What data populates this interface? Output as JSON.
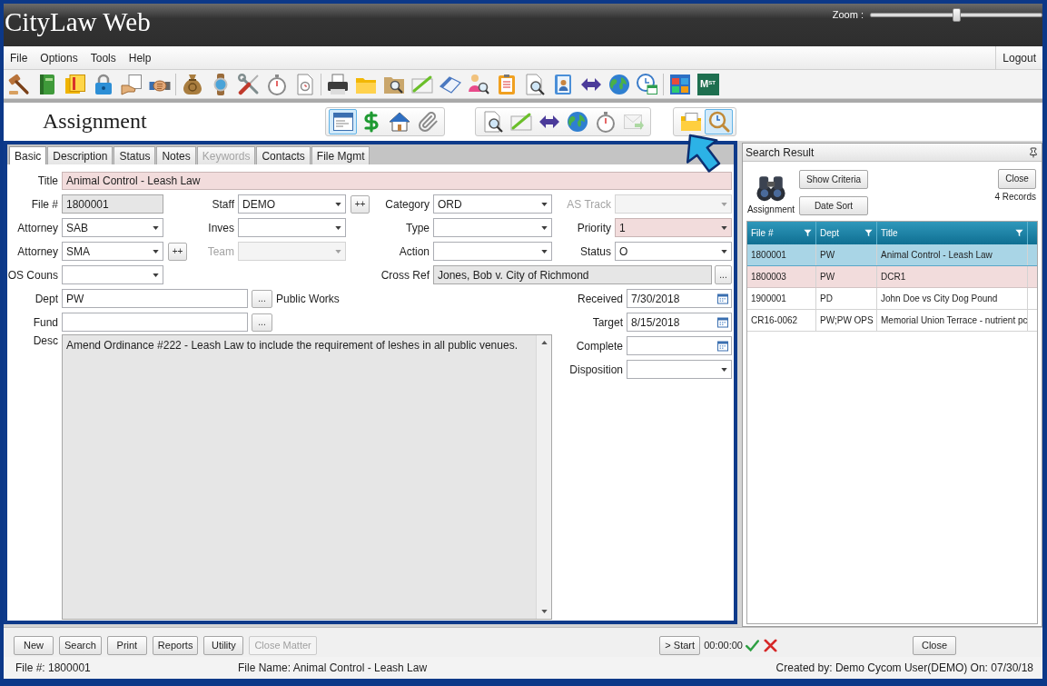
{
  "window": {
    "title": "CityLaw Web",
    "zoom": {
      "label": "Zoom :",
      "level": 0.5
    }
  },
  "menu": {
    "items": [
      "File",
      "Options",
      "Tools",
      "Help"
    ],
    "logout": "Logout"
  },
  "toolbar": {
    "logo_text": "M$^{ST}$"
  },
  "header": {
    "title": "Assignment",
    "groups": [
      {
        "buttons": [
          {
            "selected": true,
            "disabled": false
          },
          {
            "selected": false,
            "disabled": false
          },
          {
            "selected": false,
            "disabled": false
          },
          {
            "selected": false,
            "disabled": false
          }
        ]
      },
      {
        "buttons": [
          {
            "selected": false,
            "disabled": false
          },
          {
            "selected": false,
            "disabled": false
          },
          {
            "selected": false,
            "disabled": false
          },
          {
            "selected": false,
            "disabled": false
          },
          {
            "selected": false,
            "disabled": false
          },
          {
            "selected": false,
            "disabled": true
          }
        ]
      },
      {
        "buttons": [
          {
            "selected": false,
            "disabled": false
          },
          {
            "selected": true,
            "disabled": false
          }
        ]
      }
    ]
  },
  "tabs": [
    {
      "label": "Basic",
      "selected": true,
      "disabled": false
    },
    {
      "label": "Description",
      "selected": false,
      "disabled": false
    },
    {
      "label": "Status",
      "selected": false,
      "disabled": false
    },
    {
      "label": "Notes",
      "selected": false,
      "disabled": false
    },
    {
      "label": "Keywords",
      "selected": false,
      "disabled": true
    },
    {
      "label": "Contacts",
      "selected": false,
      "disabled": false
    },
    {
      "label": "File Mgmt",
      "selected": false,
      "disabled": false
    }
  ],
  "form": {
    "title": {
      "kind": "text",
      "label": "Title",
      "value": "Animal Control - Leash Law",
      "highlighted": true,
      "readonly": false,
      "disabled": false
    },
    "grid": [
      [
        {
          "kind": "text",
          "label": "File #",
          "value": "1800001",
          "highlighted": false,
          "readonly": true,
          "disabled": false
        },
        {
          "kind": "dropdown",
          "label": "Staff",
          "value": "DEMO",
          "highlighted": false,
          "readonly": false,
          "disabled": false,
          "add_button": "++"
        },
        {
          "kind": "dropdown",
          "label": "Category",
          "value": "ORD",
          "highlighted": false,
          "readonly": false,
          "disabled": false
        },
        {
          "kind": "dropdown",
          "label": "AS Track",
          "highlighted": false,
          "readonly": false,
          "disabled": true
        }
      ],
      [
        {
          "kind": "dropdown",
          "label": "Attorney",
          "value": "SAB",
          "highlighted": false,
          "readonly": false,
          "disabled": false
        },
        {
          "kind": "dropdown",
          "label": "Inves",
          "highlighted": false,
          "readonly": false,
          "disabled": false
        },
        {
          "kind": "dropdown",
          "label": "Type",
          "highlighted": false,
          "readonly": false,
          "disabled": false
        },
        {
          "kind": "dropdown",
          "label": "Priority",
          "value": "1",
          "highlighted": true,
          "readonly": false,
          "disabled": false
        }
      ],
      [
        {
          "kind": "dropdown",
          "label": "Attorney",
          "value": "SMA",
          "highlighted": false,
          "readonly": false,
          "disabled": false,
          "add_button": "++"
        },
        {
          "kind": "dropdown",
          "label": "Team",
          "highlighted": false,
          "readonly": false,
          "disabled": true
        },
        {
          "kind": "dropdown",
          "label": "Action",
          "highlighted": false,
          "readonly": false,
          "disabled": false
        },
        {
          "kind": "dropdown",
          "label": "Status",
          "value": "O",
          "highlighted": false,
          "readonly": false,
          "disabled": false
        }
      ]
    ],
    "os_couns": {
      "kind": "dropdown",
      "label": "OS Couns",
      "highlighted": false,
      "readonly": false,
      "disabled": false
    },
    "cross_ref": {
      "kind": "text",
      "label": "Cross Ref",
      "value": "Jones, Bob v. City of Richmond",
      "highlighted": false,
      "readonly": true,
      "disabled": false,
      "lookup_button": "..."
    },
    "dept": {
      "kind": "text",
      "label": "Dept",
      "value": "PW",
      "highlighted": false,
      "readonly": false,
      "disabled": false,
      "lookup_button": "...",
      "description": "Public Works"
    },
    "fund": {
      "kind": "text",
      "label": "Fund",
      "highlighted": false,
      "readonly": false,
      "disabled": false,
      "lookup_button": "..."
    },
    "desc": {
      "label": "Desc",
      "value": "Amend Ordinance #222 - Leash Law to include the requirement of leshes in all public venues.",
      "highlighted": false,
      "readonly": true,
      "disabled": false
    },
    "right_fields": [
      {
        "kind": "date",
        "label": "Received",
        "value": "7/30/2018",
        "highlighted": false,
        "readonly": false,
        "disabled": false
      },
      {
        "kind": "date",
        "label": "Target",
        "value": "8/15/2018",
        "highlighted": false,
        "readonly": false,
        "disabled": false
      },
      {
        "kind": "date",
        "label": "Complete",
        "highlighted": false,
        "readonly": false,
        "disabled": false
      },
      {
        "kind": "dropdown",
        "label": "Disposition",
        "highlighted": false,
        "readonly": false,
        "disabled": false
      }
    ]
  },
  "search_result": {
    "title": "Search Result",
    "source_label": "Assignment",
    "buttons": [
      "Show Criteria",
      "Date Sort"
    ],
    "close": "Close",
    "count": "4 Records",
    "table": {
      "columns": [
        "File #",
        "Dept",
        "Title"
      ],
      "rows": [
        {
          "cells": [
            "1800001",
            "PW",
            "Animal Control - Leash Law"
          ],
          "selected": true,
          "highlighted": false
        },
        {
          "cells": [
            "1800003",
            "PW",
            "DCR1"
          ],
          "selected": false,
          "highlighted": true
        },
        {
          "cells": [
            "1900001",
            "PD",
            "John Doe vs City Dog Pound"
          ],
          "selected": false,
          "highlighted": false
        },
        {
          "cells": [
            "CR16-0062",
            "PW;PW OPS",
            "Memorial Union Terrace - nutrient pc"
          ],
          "selected": false,
          "highlighted": false
        }
      ]
    }
  },
  "actions": {
    "buttons": [
      {
        "label": "New",
        "disabled": false
      },
      {
        "label": "Search",
        "disabled": false
      },
      {
        "label": "Print",
        "disabled": false
      },
      {
        "label": "Reports",
        "disabled": false
      },
      {
        "label": "Utility",
        "disabled": false
      },
      {
        "label": "Close Matter",
        "disabled": true
      }
    ],
    "start": "> Start",
    "timer": "00:00:00",
    "close": "Close"
  },
  "status_bar": {
    "file_no": "File #: 1800001",
    "file_name": "File Name: Animal Control - Leash Law",
    "created": "Created by: Demo Cycom User(DEMO) On: 07/30/18"
  }
}
